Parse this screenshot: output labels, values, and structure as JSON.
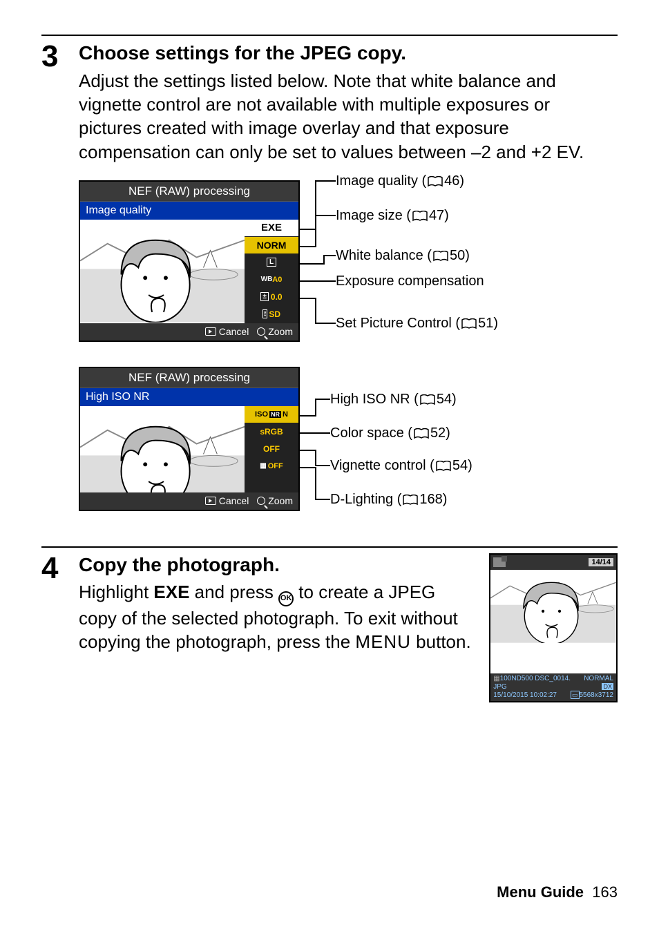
{
  "step3": {
    "number": "3",
    "title": "Choose settings for the JPEG copy.",
    "body": "Adjust the settings listed below.  Note that white balance and vignette control are not available with multiple exposures or pictures created with image overlay and that exposure compensation can only be set to values between –2 and +2 EV."
  },
  "screen1": {
    "title": "NEF (RAW) processing",
    "subtitle": "Image quality",
    "menu": {
      "exe": "EXE",
      "norm": "NORM",
      "size_icon": "L",
      "wb": "A0",
      "exp_icon": "±",
      "exp": "0.0",
      "pc": "SD"
    },
    "footer": {
      "cancel": "Cancel",
      "zoom": "Zoom"
    },
    "callouts": {
      "quality": "Image quality (",
      "quality_p": "46)",
      "size": "Image size (",
      "size_p": "47)",
      "wb": "White balance (",
      "wb_p": "50)",
      "exp": "Exposure compensation",
      "pc": "Set Picture Control (",
      "pc_p": "51)"
    }
  },
  "screen2": {
    "title": "NEF (RAW) processing",
    "subtitle": "High ISO NR",
    "menu": {
      "iso": "N",
      "iso_prefix": "ISO",
      "iso_nr": "NR",
      "cs": "sRGB",
      "vig": "OFF",
      "dl": "OFF"
    },
    "footer": {
      "cancel": "Cancel",
      "zoom": "Zoom"
    },
    "callouts": {
      "iso": "High ISO NR (",
      "iso_p": "54)",
      "cs": "Color space (",
      "cs_p": "52)",
      "vig": "Vignette control (",
      "vig_p": "54)",
      "dl": "D-Lighting (",
      "dl_p": "168)"
    }
  },
  "step4": {
    "number": "4",
    "title": "Copy the photograph.",
    "body1": "Highlight ",
    "exe": "EXE",
    "body2": " and press ",
    "body3": " to create a JPEG copy of the selected photograph.  To exit without copying the photograph, press the ",
    "menu": "MENU",
    "body4": " button."
  },
  "result": {
    "frame": "14/14",
    "folder": "100ND500",
    "file": "DSC_0014. JPG",
    "date": "15/10/2015 10:02:27",
    "quality": "NORMAL",
    "dims": "5568x3712",
    "crop": "DX"
  },
  "footer": {
    "label": "Menu Guide",
    "page": "163"
  }
}
